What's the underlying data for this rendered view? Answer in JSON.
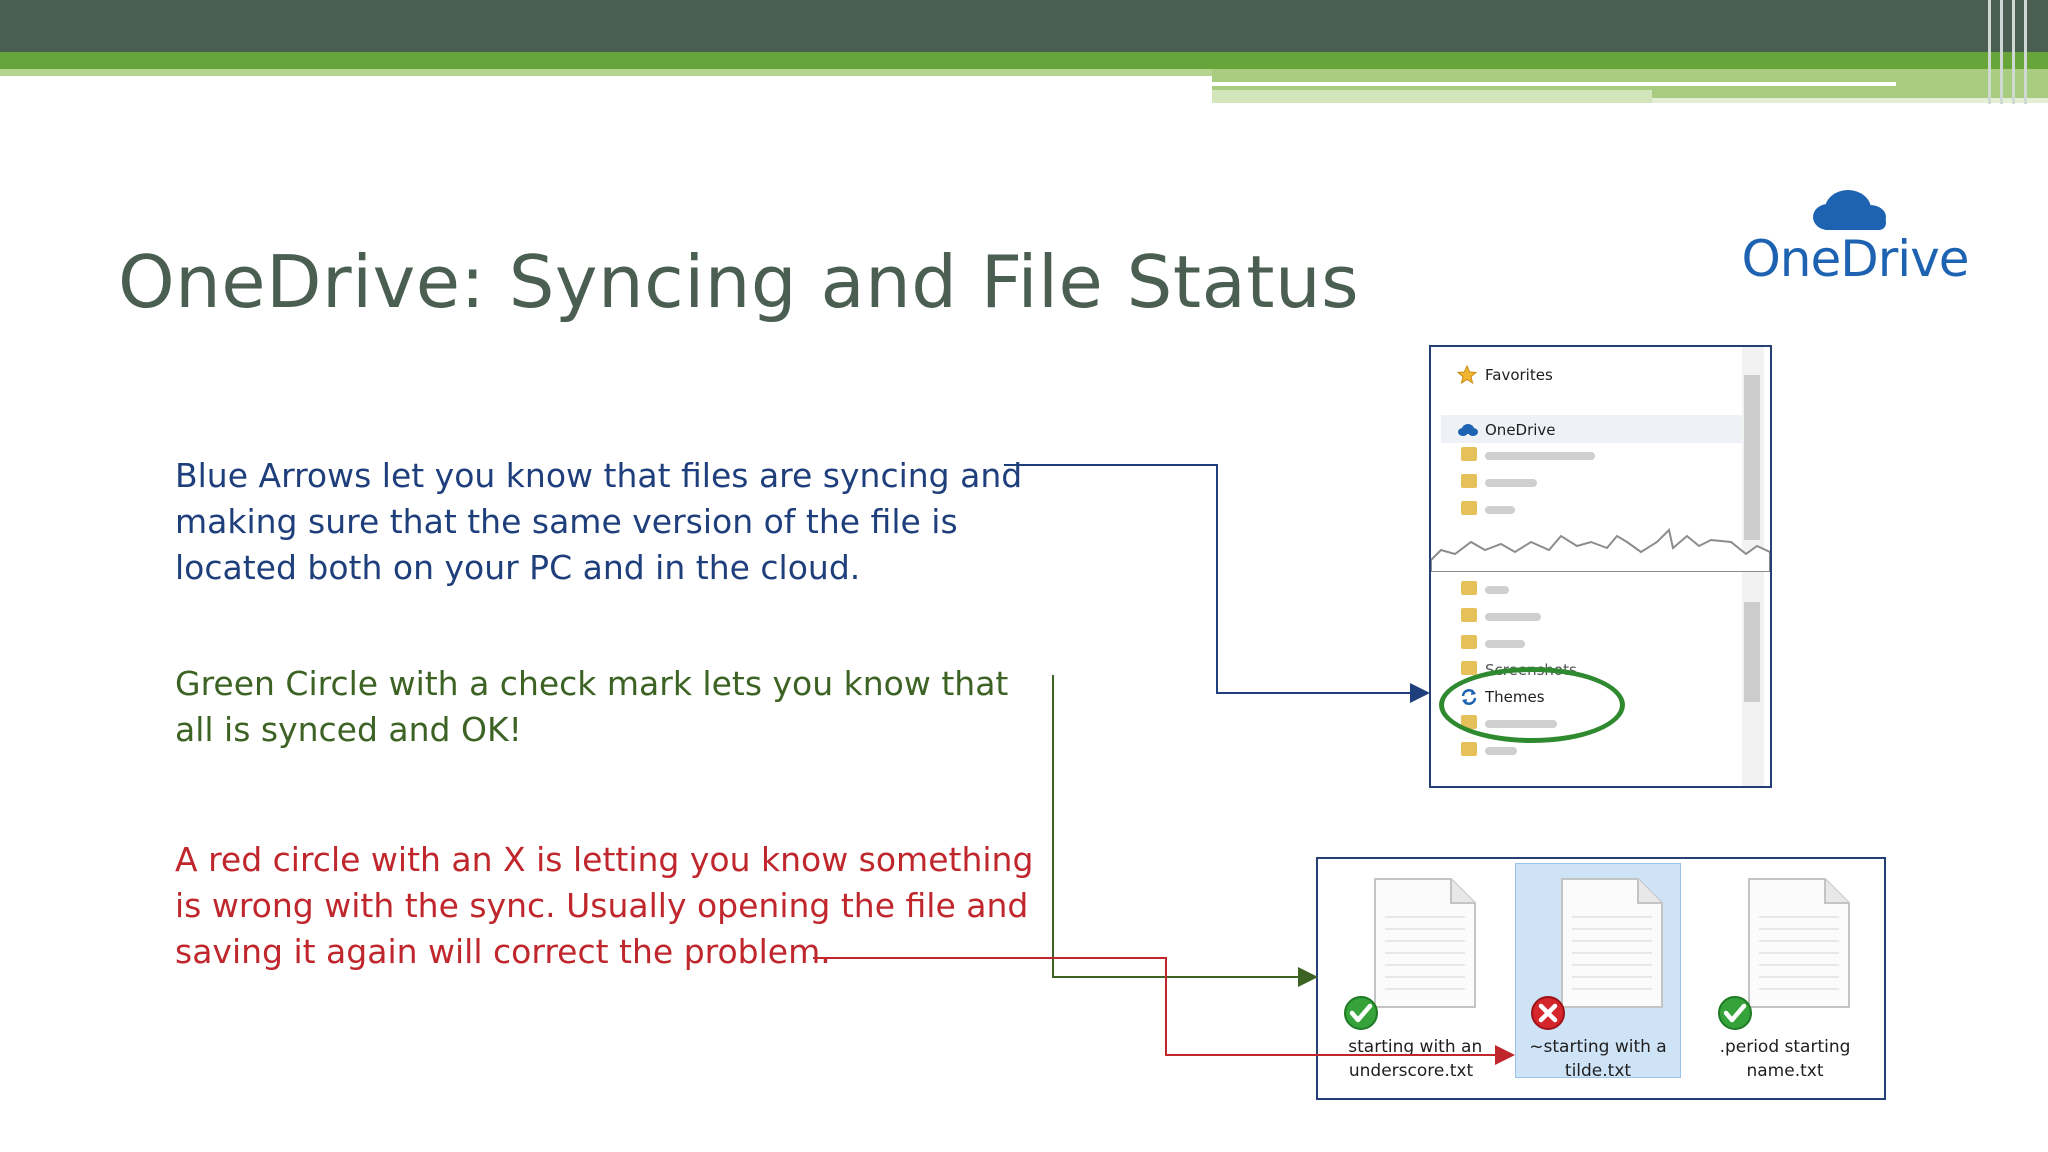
{
  "slide": {
    "title": "OneDrive: Syncing and File Status",
    "logo_text": "OneDrive",
    "logo_icon": "onedrive-cloud-icon",
    "colors": {
      "header_dark": "#4a5e52",
      "header_green": "#67a53b",
      "title": "#4a5e52",
      "blue_text": "#1f3f7c",
      "green_text": "#3d6324",
      "red_text": "#c0272d",
      "logo_blue": "#1e63b2"
    }
  },
  "paragraphs": {
    "blue": "Blue Arrows let you know that files are syncing and making sure that the same version of the file is located both on your PC and in the cloud.",
    "green": "Green Circle with a check mark lets you know that all is synced and OK!",
    "red": "A red circle with an X is letting you know something is wrong with the sync. Usually opening the file and saving it again will correct the problem."
  },
  "explorer": {
    "favorites": "Favorites",
    "onedrive": "OneDrive",
    "screenshots": "Screenshots",
    "themes": "Themes"
  },
  "files": [
    {
      "name": "_starting with an underscore.txt",
      "status": "synced",
      "badge_icon": "green-check-icon"
    },
    {
      "name": "~starting with a tilde.txt",
      "status": "error",
      "badge_icon": "red-x-icon"
    },
    {
      "name": ".period starting name.txt",
      "status": "synced",
      "badge_icon": "green-check-icon"
    }
  ]
}
